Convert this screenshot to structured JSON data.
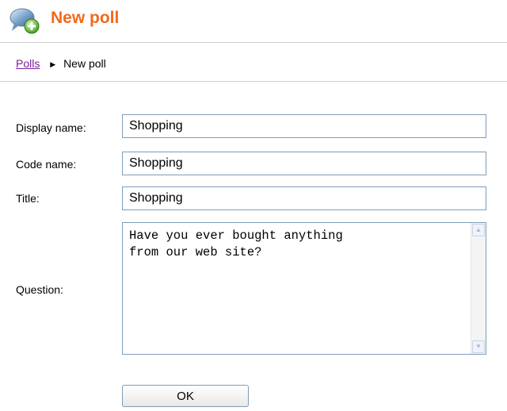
{
  "header": {
    "title": "New poll",
    "icon": "poll-add-icon",
    "title_color": "#f26a1b"
  },
  "breadcrumb": {
    "parent_label": "Polls",
    "separator_icon": "triangle-right-icon",
    "current_label": "New poll",
    "link_color": "#7a1f9b"
  },
  "form": {
    "display_name": {
      "label": "Display name:",
      "value": "Shopping"
    },
    "code_name": {
      "label": "Code name:",
      "value": "Shopping"
    },
    "title": {
      "label": "Title:",
      "value": "Shopping"
    },
    "question": {
      "label": "Question:",
      "value": "Have you ever bought anything\nfrom our web site?"
    },
    "ok_label": "OK"
  }
}
